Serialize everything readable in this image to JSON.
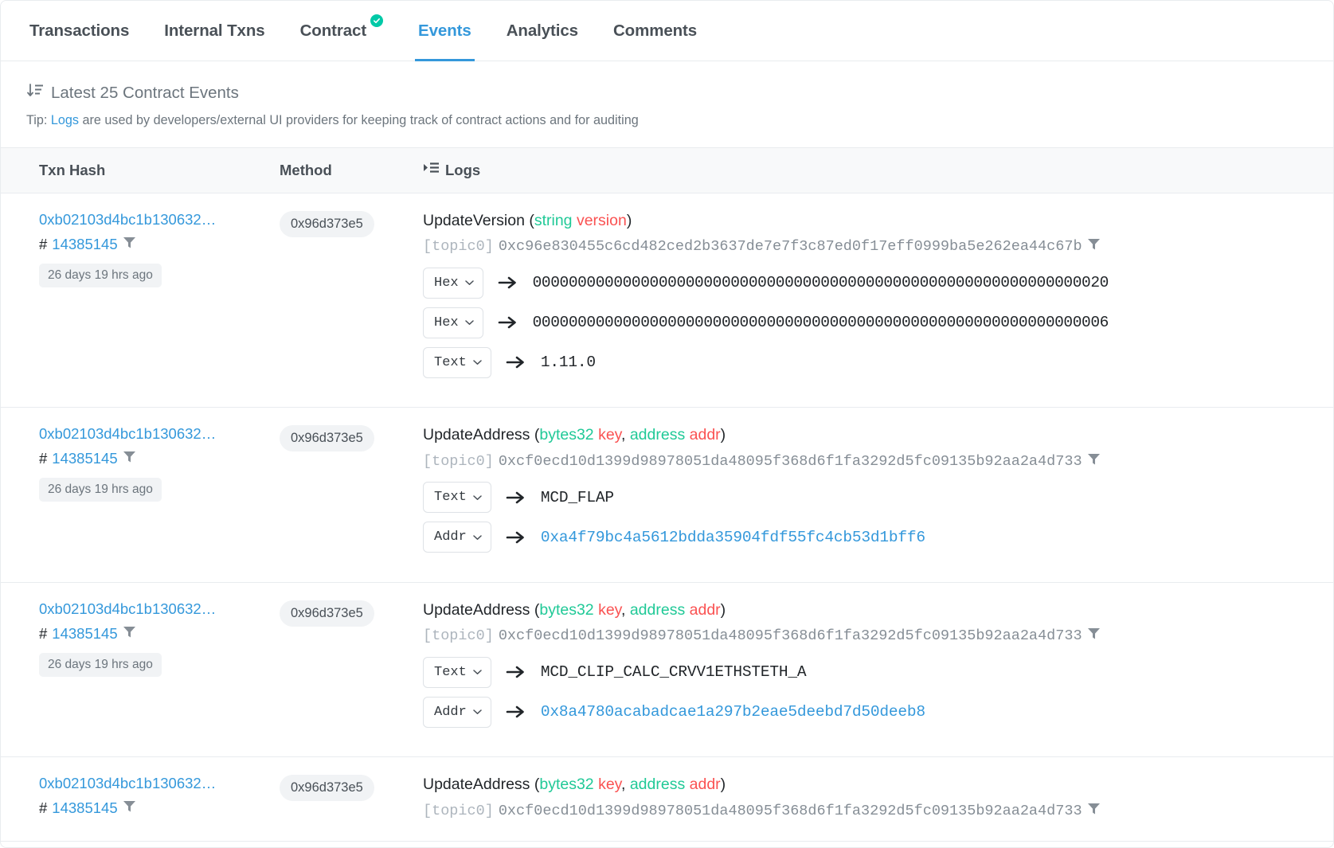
{
  "tabs": [
    {
      "id": "transactions",
      "label": "Transactions",
      "active": false,
      "verified": false
    },
    {
      "id": "internal-txns",
      "label": "Internal Txns",
      "active": false,
      "verified": false
    },
    {
      "id": "contract",
      "label": "Contract",
      "active": false,
      "verified": true
    },
    {
      "id": "events",
      "label": "Events",
      "active": true,
      "verified": false
    },
    {
      "id": "analytics",
      "label": "Analytics",
      "active": false,
      "verified": false
    },
    {
      "id": "comments",
      "label": "Comments",
      "active": false,
      "verified": false
    }
  ],
  "heading": {
    "title": "Latest 25 Contract Events",
    "sort_icon": "sort-descending-icon",
    "tip_prefix": "Tip: ",
    "tip_link": "Logs",
    "tip_rest": " are used by developers/external UI providers for keeping track of contract actions and for auditing"
  },
  "table": {
    "columns": {
      "txn_hash": "Txn Hash",
      "method": "Method",
      "logs": "Logs",
      "logs_icon": "logs-list-icon"
    },
    "rows": [
      {
        "txn_hash": "0xb02103d4bc1b130632…",
        "block": "14385145",
        "block_prefix": "#",
        "age": "26 days 19 hrs ago",
        "method": "0x96d373e5",
        "event_name": "UpdateVersion",
        "params": [
          {
            "type": "string",
            "name": "version"
          }
        ],
        "topic_label": "[topic0]",
        "topic_value": "0xc96e830455c6cd482ced2b3637de7e7f3c87ed0f17eff0999ba5e262ea44c67b",
        "data": [
          {
            "format": "Hex",
            "value": "0000000000000000000000000000000000000000000000000000000000000020",
            "kind": "hex"
          },
          {
            "format": "Hex",
            "value": "0000000000000000000000000000000000000000000000000000000000000006",
            "kind": "hex"
          },
          {
            "format": "Text",
            "value": "1.11.0",
            "kind": "text"
          }
        ]
      },
      {
        "txn_hash": "0xb02103d4bc1b130632…",
        "block": "14385145",
        "block_prefix": "#",
        "age": "26 days 19 hrs ago",
        "method": "0x96d373e5",
        "event_name": "UpdateAddress",
        "params": [
          {
            "type": "bytes32",
            "name": "key"
          },
          {
            "type": "address",
            "name": "addr"
          }
        ],
        "topic_label": "[topic0]",
        "topic_value": "0xcf0ecd10d1399d98978051da48095f368d6f1fa3292d5fc09135b92aa2a4d733",
        "data": [
          {
            "format": "Text",
            "value": "MCD_FLAP",
            "kind": "text"
          },
          {
            "format": "Addr",
            "value": "0xa4f79bc4a5612bdda35904fdf55fc4cb53d1bff6",
            "kind": "addr"
          }
        ]
      },
      {
        "txn_hash": "0xb02103d4bc1b130632…",
        "block": "14385145",
        "block_prefix": "#",
        "age": "26 days 19 hrs ago",
        "method": "0x96d373e5",
        "event_name": "UpdateAddress",
        "params": [
          {
            "type": "bytes32",
            "name": "key"
          },
          {
            "type": "address",
            "name": "addr"
          }
        ],
        "topic_label": "[topic0]",
        "topic_value": "0xcf0ecd10d1399d98978051da48095f368d6f1fa3292d5fc09135b92aa2a4d733",
        "data": [
          {
            "format": "Text",
            "value": "MCD_CLIP_CALC_CRVV1ETHSTETH_A",
            "kind": "text"
          },
          {
            "format": "Addr",
            "value": "0x8a4780acabadcae1a297b2eae5deebd7d50deeb8",
            "kind": "addr"
          }
        ]
      },
      {
        "txn_hash": "0xb02103d4bc1b130632…",
        "block": "14385145",
        "block_prefix": "#",
        "age": "",
        "method": "0x96d373e5",
        "event_name": "UpdateAddress",
        "params": [
          {
            "type": "bytes32",
            "name": "key"
          },
          {
            "type": "address",
            "name": "addr"
          }
        ],
        "topic_label": "[topic0]",
        "topic_value": "0xcf0ecd10d1399d98978051da48095f368d6f1fa3292d5fc09135b92aa2a4d733",
        "data": []
      }
    ]
  },
  "colors": {
    "accent": "#3498db",
    "type": "#20c997",
    "param": "#fa5252",
    "muted": "#6c757d",
    "verified": "#00c9a7"
  }
}
